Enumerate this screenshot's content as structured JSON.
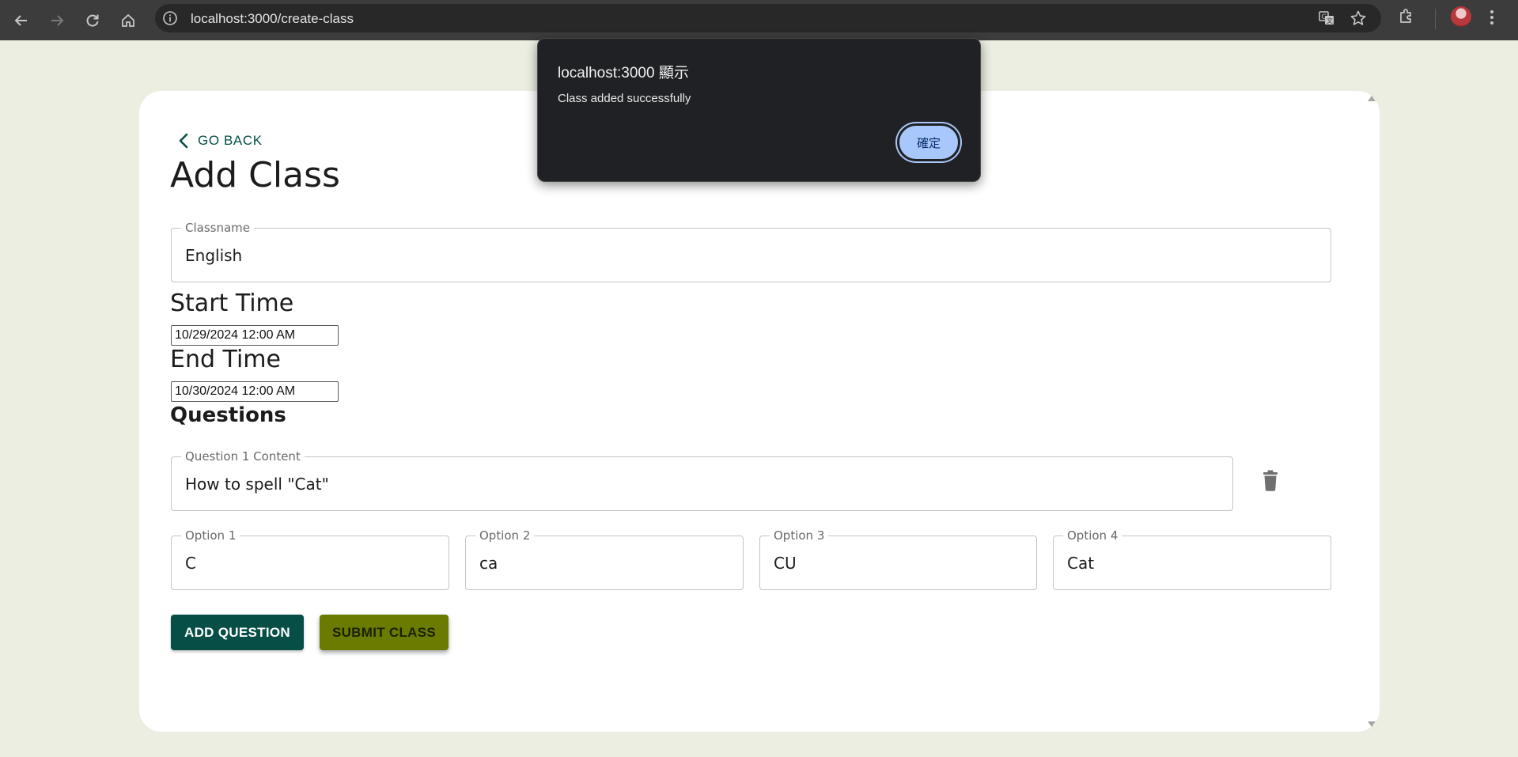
{
  "browser": {
    "url": "localhost:3000/create-class",
    "icons": [
      "back-icon",
      "forward-icon",
      "reload-icon",
      "home-icon",
      "site-info-icon",
      "translate-icon",
      "bookmark-star-icon",
      "extensions-icon",
      "profile-avatar",
      "more-menu-icon"
    ]
  },
  "page": {
    "go_back_label": "GO BACK",
    "title": "Add Class",
    "classname": {
      "label": "Classname",
      "value": "English"
    },
    "start_time": {
      "heading": "Start Time",
      "value": "10/29/2024 12:00 AM"
    },
    "end_time": {
      "heading": "End Time",
      "value": "10/30/2024 12:00 AM"
    },
    "questions_heading": "Questions",
    "questions": [
      {
        "content_label": "Question 1 Content",
        "content_value": "How to spell \"Cat\"",
        "options": [
          {
            "label": "Option 1",
            "value": "C"
          },
          {
            "label": "Option 2",
            "value": "ca"
          },
          {
            "label": "Option 3",
            "value": "CU"
          },
          {
            "label": "Option 4",
            "value": "Cat"
          }
        ]
      }
    ],
    "add_question_label": "ADD QUESTION",
    "submit_class_label": "SUBMIT CLASS"
  },
  "dialog": {
    "title": "localhost:3000 顯示",
    "message": "Class added successfully",
    "ok_label": "確定"
  },
  "colors": {
    "page_background": "#ebeee1",
    "primary": "#064e46",
    "submit": "#6b7a00",
    "dialog_background": "#202124",
    "dialog_button": "#a8c7fa"
  }
}
